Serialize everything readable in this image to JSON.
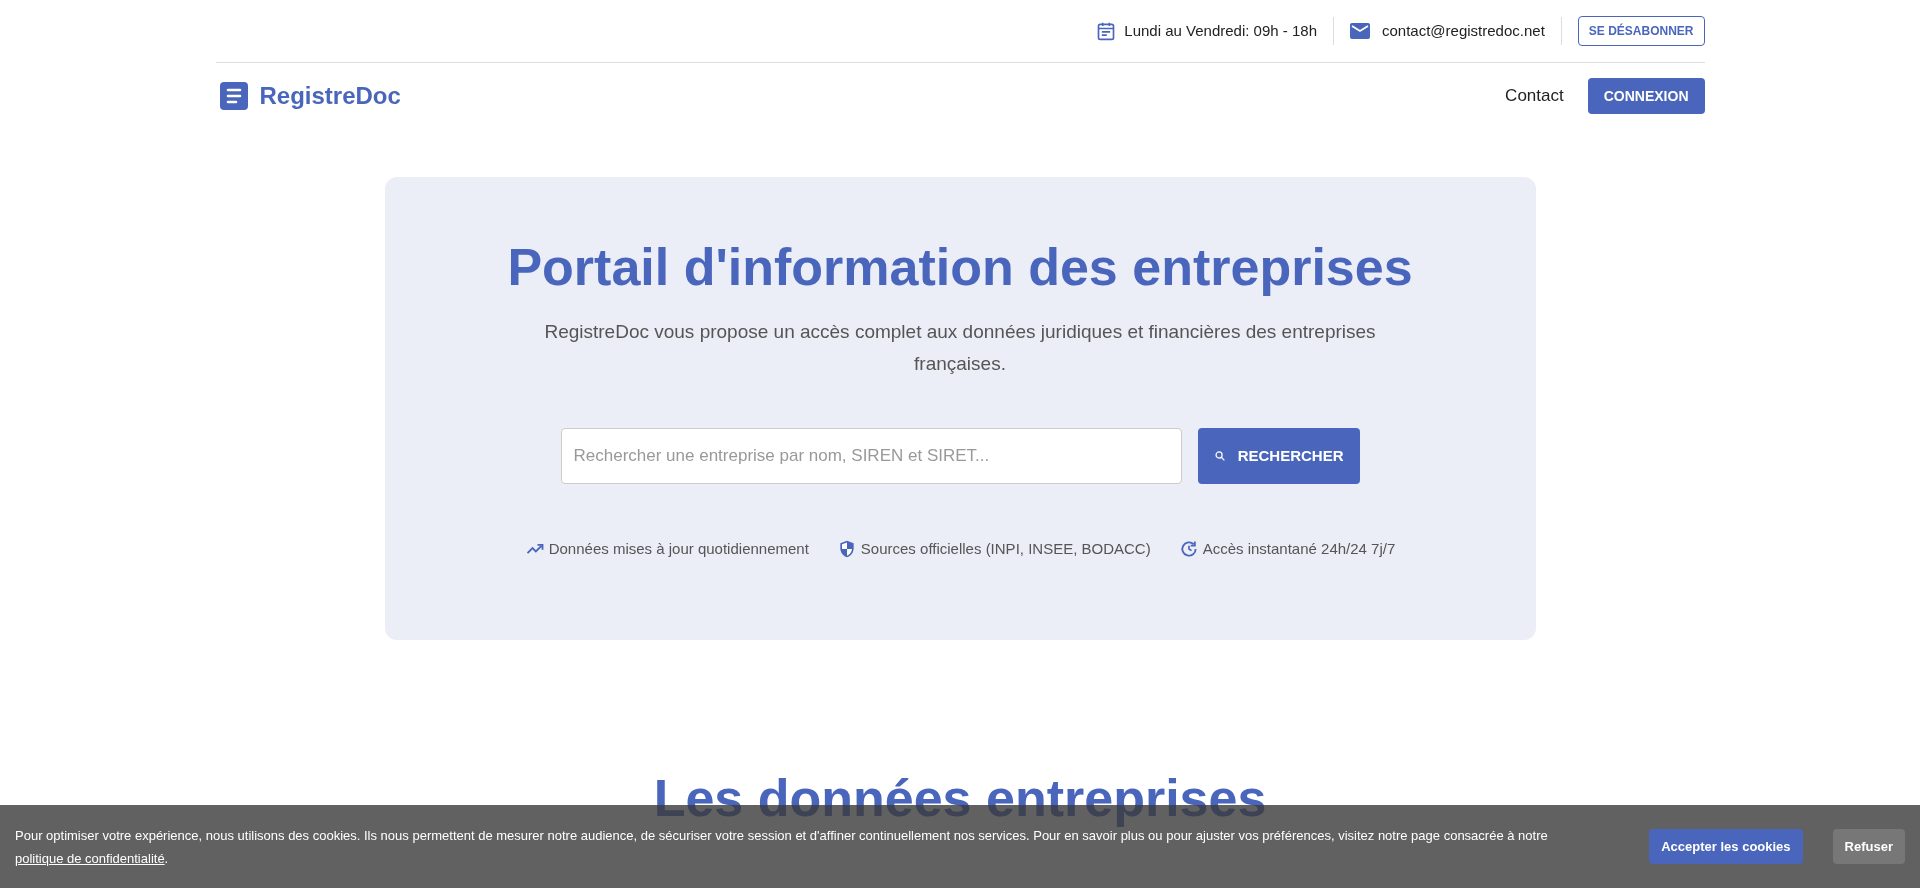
{
  "top_bar": {
    "hours": "Lundi au Vendredi: 09h - 18h",
    "email": "contact@registredoc.net",
    "unsubscribe": "SE DÉSABONNER"
  },
  "nav": {
    "logo": "RegistreDoc",
    "links": [
      "Contact"
    ],
    "login": "CONNEXION"
  },
  "hero": {
    "title": "Portail d'information des entreprises",
    "subtitle": "RegistreDoc vous propose un accès complet aux données juridiques et financières des entreprises françaises.",
    "search": {
      "placeholder": "Rechercher une entreprise par nom, SIREN et SIRET...",
      "button": "RECHERCHER"
    },
    "features": [
      {
        "kind": "trend",
        "label": "Données mises à jour quotidiennement"
      },
      {
        "kind": "shield",
        "label": "Sources officielles (INPI, INSEE, BODACC)"
      },
      {
        "kind": "clock",
        "label": "Accès instantané 24h/24 7j/7"
      }
    ]
  },
  "section": {
    "title": "Les données entreprises"
  },
  "cookie_banner": {
    "text": "Pour optimiser votre expérience, nous utilisons des cookies. Ils nous permettent de mesurer notre audience, de sécuriser votre session et d'affiner continuellement nos services. Pour en savoir plus ou pour ajuster vos préférences, visitez notre page consacrée à notre",
    "link": "politique de confidentialité",
    "after_link": ".",
    "accept": "Accepter les cookies",
    "refuse": "Refuser"
  }
}
